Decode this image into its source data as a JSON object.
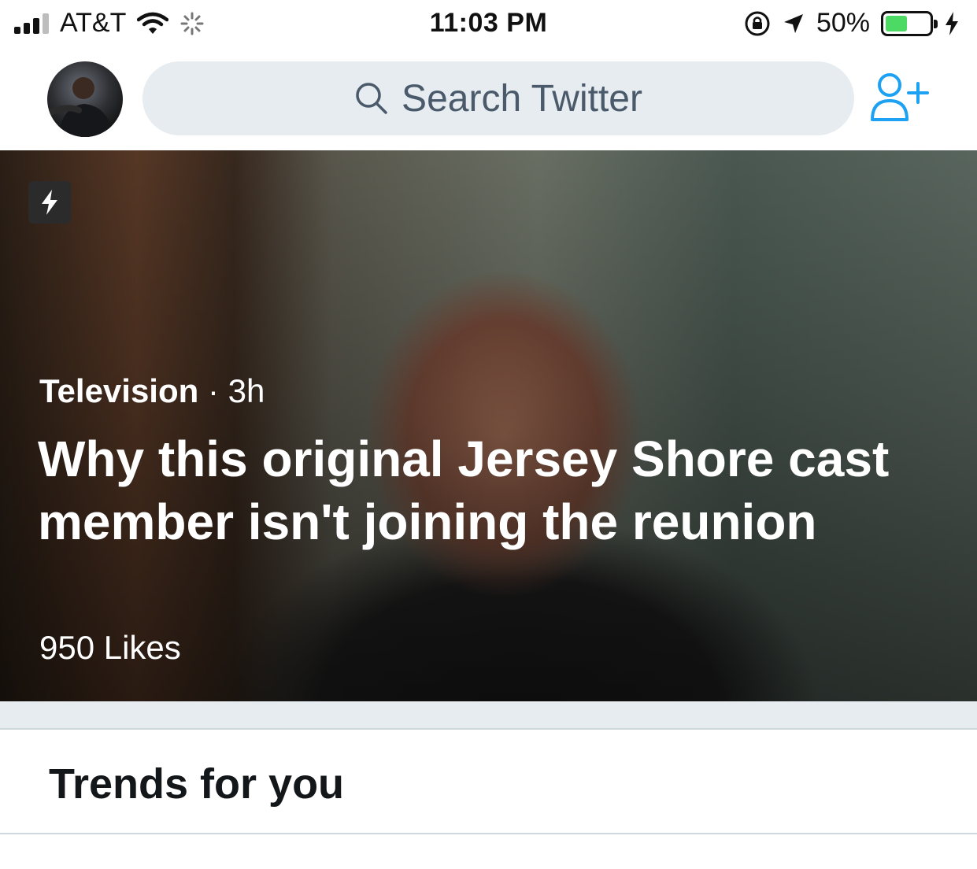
{
  "status_bar": {
    "carrier": "AT&T",
    "time": "11:03 PM",
    "battery_percent": "50%",
    "battery_level": 0.5,
    "signal_bars": 4,
    "signal_bars_active": 3,
    "icons": [
      "signal-icon",
      "wifi-icon",
      "activity-spinner-icon",
      "rotation-lock-icon",
      "location-arrow-icon",
      "battery-icon",
      "charging-bolt-icon"
    ],
    "battery_color": "#4cd964"
  },
  "header": {
    "search_placeholder": "Search Twitter",
    "search_bg": "#e6ecf0",
    "icons": [
      "avatar",
      "search-icon",
      "add-user-icon"
    ]
  },
  "hero": {
    "category": "Television",
    "separator": "·",
    "age": "3h",
    "title": "Why this original Jersey Shore cast member isn't joining the reunion",
    "likes": "950 Likes",
    "badge_icon": "lightning-bolt-icon"
  },
  "trends": {
    "title": "Trends for you"
  }
}
